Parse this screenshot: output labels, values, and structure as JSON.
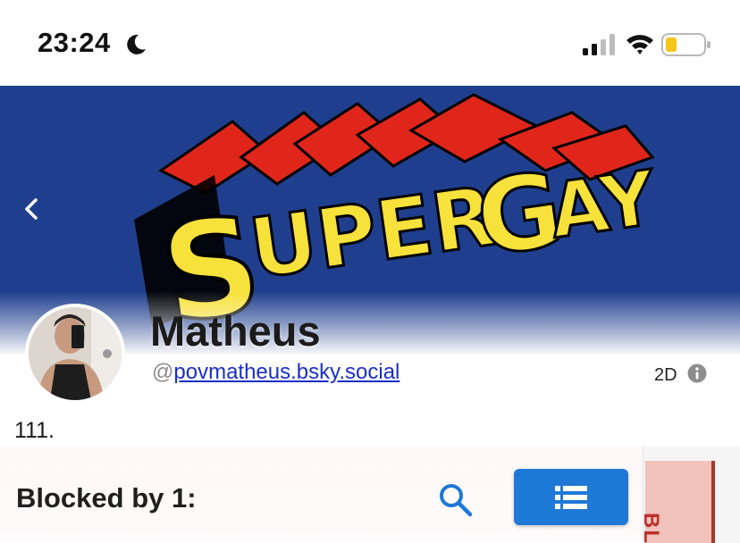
{
  "status_bar": {
    "time": "23:24",
    "icons": [
      "moon-icon",
      "signal-icon",
      "wifi-icon",
      "battery-icon"
    ],
    "battery_color": "#f5c518"
  },
  "banner": {
    "text": "SUPERGAY",
    "background_color": "#1f3f8e",
    "letter_color": "#f7e13b",
    "extrusion_color": "#e0261b"
  },
  "profile": {
    "display_name": "Matheus",
    "handle_prefix": "@",
    "handle": "povmatheus.bsky.social",
    "age": "2D",
    "bio": "111."
  },
  "blocked": {
    "heading": "Blocked by 1:",
    "accent_color": "#1e78d6"
  },
  "side_tab": {
    "label": "BL"
  }
}
